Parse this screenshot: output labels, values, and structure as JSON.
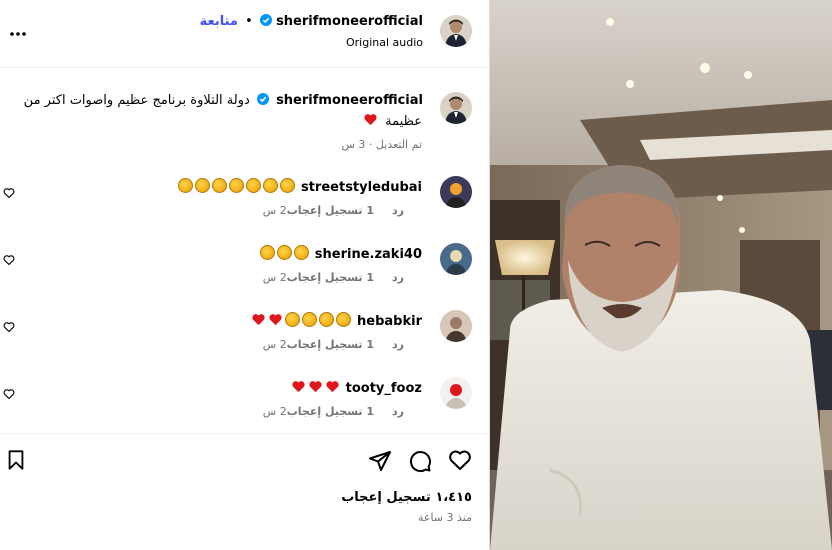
{
  "header": {
    "follow_label": "متابعة",
    "separator": "•",
    "username": "sherifmoneerofficial",
    "audio": "Original audio",
    "more_label": "•••"
  },
  "caption": {
    "username": "sherifmoneerofficial",
    "text_line1": "دولة التلاوة برنامج عظيم واصوات اكتر من",
    "text_line2": "عظيمة",
    "edited": "تم التعديل · 3 س"
  },
  "comments": [
    {
      "username": "streetstyledubai",
      "time": "2 س",
      "likes": "1 تسجيل إعجاب",
      "reply": "رد",
      "emojis": [
        "clap",
        "clap",
        "clap",
        "clap",
        "clap",
        "clap",
        "clap"
      ]
    },
    {
      "username": "sherine.zaki40",
      "time": "2 س",
      "likes": "1 تسجيل إعجاب",
      "reply": "رد",
      "emojis": [
        "clap",
        "clap",
        "clap"
      ]
    },
    {
      "username": "hebabkir",
      "time": "2 س",
      "likes": "1 تسجيل إعجاب",
      "reply": "رد",
      "emojis": [
        "heart",
        "heart",
        "clap",
        "clap",
        "clap",
        "clap"
      ]
    },
    {
      "username": "tooty_fooz",
      "time": "2 س",
      "likes": "1 تسجيل إعجاب",
      "reply": "رد",
      "emojis": [
        "heart",
        "heart",
        "heart"
      ]
    }
  ],
  "footer": {
    "like_count": "١،٤١٥ تسجيل إعجاب",
    "time_ago": "منذ 3 ساعة"
  },
  "colors": {
    "link_blue": "#0095f6",
    "follow_blue": "#4150f7",
    "muted": "#737373",
    "heart_red": "#e0161d",
    "verified_blue": "#0095f6"
  }
}
